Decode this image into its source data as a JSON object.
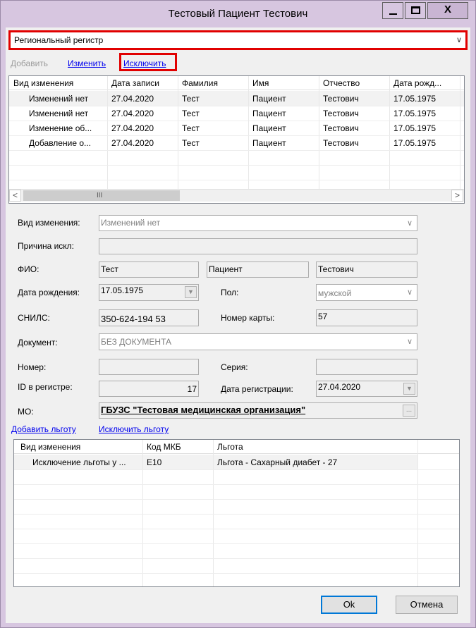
{
  "window": {
    "title": "Тестовый Пациент Тестович",
    "min_glyph": "minimize-icon",
    "max_glyph": "maximize-icon",
    "close_glyph": "X"
  },
  "registry": {
    "selected": "Региональный регистр"
  },
  "toolbar": {
    "add_label": "Добавить",
    "edit_label": "Изменить",
    "exclude_label": "Исключить"
  },
  "records": {
    "columns": [
      "Вид изменения",
      "Дата записи",
      "Фамилия",
      "Имя",
      "Отчество",
      "Дата рожд..."
    ],
    "rows": [
      [
        "Изменений нет",
        "27.04.2020",
        "Тест",
        "Пациент",
        "Тестович",
        "17.05.1975"
      ],
      [
        "Изменений нет",
        "27.04.2020",
        "Тест",
        "Пациент",
        "Тестович",
        "17.05.1975"
      ],
      [
        "Изменение об...",
        "27.04.2020",
        "Тест",
        "Пациент",
        "Тестович",
        "17.05.1975"
      ],
      [
        "Добавление о...",
        "27.04.2020",
        "Тест",
        "Пациент",
        "Тестович",
        "17.05.1975"
      ]
    ],
    "scroll_thumb_glyph": "III"
  },
  "form": {
    "change_type_label": "Вид изменения:",
    "change_type_value": "Изменений нет",
    "exclusion_reason_label": "Причина искл:",
    "exclusion_reason_value": "",
    "fio_label": "ФИО:",
    "last_name": "Тест",
    "first_name": "Пациент",
    "patronymic": "Тестович",
    "birth_date_label": "Дата рождения:",
    "birth_date": "17.05.1975",
    "sex_label": "Пол:",
    "sex_value": "мужской",
    "snils_label": "СНИЛС:",
    "snils_value": "350-624-194 53",
    "card_number_label": "Номер карты:",
    "card_number_value": "57",
    "document_label": "Документ:",
    "document_value": "БЕЗ ДОКУМЕНТА",
    "number_label": "Номер:",
    "number_value": "",
    "series_label": "Серия:",
    "series_value": "",
    "registry_id_label": "ID в регистре:",
    "registry_id_value": "17",
    "registration_date_label": "Дата регистрации:",
    "registration_date_value": "27.04.2020",
    "mo_label": "МО:",
    "mo_value": "ГБУЗС \"Тестовая медицинская организация\"",
    "mo_button": "..."
  },
  "benefits": {
    "add_label": "Добавить льготу",
    "exclude_label": "Исключить льготу",
    "columns": [
      "Вид изменения",
      "Код МКБ",
      "Льгота"
    ],
    "rows": [
      [
        "Исключение льготы у ...",
        "E10",
        "Льгота - Сахарный диабет - 27"
      ]
    ]
  },
  "buttons": {
    "ok_label": "Ok",
    "cancel_label": "Отмена"
  },
  "colors": {
    "highlight": "#e10000",
    "link": "#0000ee",
    "titlebar": "#d7c6e0"
  }
}
